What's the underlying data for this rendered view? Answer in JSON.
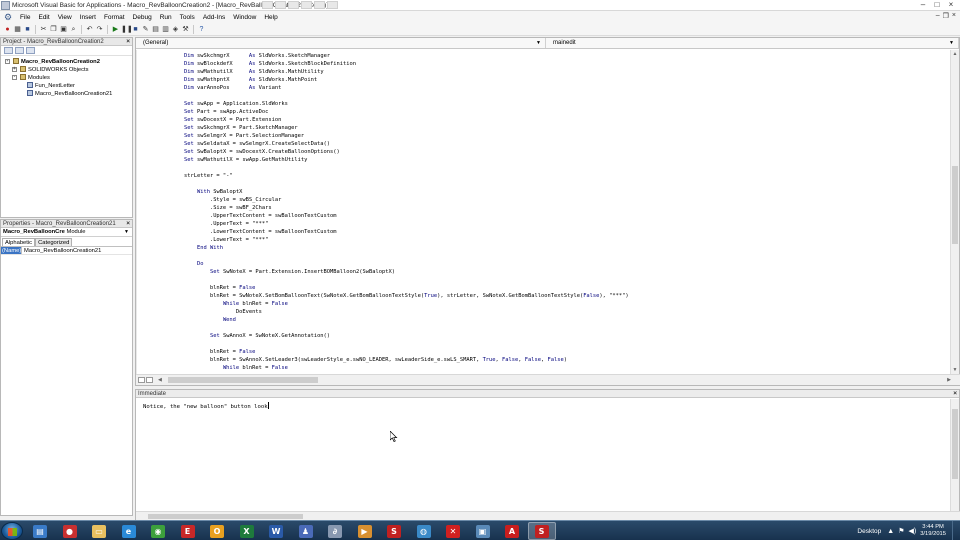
{
  "window": {
    "title": "Microsoft Visual Basic for Applications - Macro_RevBalloonCreation2 - [Macro_RevBalloonCreation21 (Code)]"
  },
  "menu": {
    "items": [
      "File",
      "Edit",
      "View",
      "Insert",
      "Format",
      "Debug",
      "Run",
      "Tools",
      "Add-Ins",
      "Window",
      "Help"
    ]
  },
  "project_pane": {
    "title": "Project - Macro_RevBalloonCreation2",
    "tree": [
      {
        "label": "Macro_RevBalloonCreation2",
        "indent": 0,
        "expander": "-",
        "bold": true,
        "icon": "project-icon"
      },
      {
        "label": "SOLIDWORKS Objects",
        "indent": 1,
        "expander": "+",
        "bold": false,
        "icon": "folder-icon"
      },
      {
        "label": "Modules",
        "indent": 1,
        "expander": "-",
        "bold": false,
        "icon": "folder-icon"
      },
      {
        "label": "Fun_NextLetter",
        "indent": 2,
        "expander": "",
        "bold": false,
        "icon": "module-icon"
      },
      {
        "label": "Macro_RevBalloonCreation21",
        "indent": 2,
        "expander": "",
        "bold": false,
        "icon": "module-icon"
      }
    ]
  },
  "properties_pane": {
    "title": "Properties - Macro_RevBalloonCreation21",
    "object_name": "Macro_RevBalloonCre",
    "object_type": "Module",
    "tabs": [
      "Alphabetic",
      "Categorized"
    ],
    "rows": [
      {
        "name": "(Name)",
        "value": "Macro_RevBalloonCreation21"
      }
    ]
  },
  "code_window": {
    "object_combo": "(General)",
    "procedure_combo": "mainedit",
    "lines": [
      {
        "text": "    Dim swSkchmgrX      As SldWorks.SketchManager",
        "kw": true
      },
      {
        "text": "    Dim swBlockdefX     As SldWorks.SketchBlockDefinition",
        "kw": true
      },
      {
        "text": "    Dim swMathutilX     As SldWorks.MathUtility",
        "kw": true
      },
      {
        "text": "    Dim swMathpntX      As SldWorks.MathPoint",
        "kw": true
      },
      {
        "text": "    Dim varAnnoPos      As Variant",
        "kw": true
      },
      {
        "text": "",
        "kw": false
      },
      {
        "text": "    Set swApp = Application.SldWorks",
        "kw": true
      },
      {
        "text": "    Set Part = swApp.ActiveDoc",
        "kw": true
      },
      {
        "text": "    Set swDocextX = Part.Extension",
        "kw": true
      },
      {
        "text": "    Set swSkchmgrX = Part.SketchManager",
        "kw": true
      },
      {
        "text": "    Set swSelmgrX = Part.SelectionManager",
        "kw": true
      },
      {
        "text": "    Set swSeldataX = swSelmgrX.CreateSelectData()",
        "kw": true
      },
      {
        "text": "    Set SwBaloptX = swDocextX.CreateBalloonOptions()",
        "kw": true
      },
      {
        "text": "    Set swMathutilX = swApp.GetMathUtility",
        "kw": true
      },
      {
        "text": "",
        "kw": false
      },
      {
        "text": "    strLetter = \"-\"",
        "kw": false
      },
      {
        "text": "",
        "kw": false
      },
      {
        "text": "        With SwBaloptX",
        "kw": true
      },
      {
        "text": "            .Style = swBS_Circular",
        "kw": false
      },
      {
        "text": "            .Size = swBF_2Chars",
        "kw": false
      },
      {
        "text": "            .UpperTextContent = swBalloonTextCustom",
        "kw": false
      },
      {
        "text": "            .UpperText = \"***\"",
        "kw": false
      },
      {
        "text": "            .LowerTextContent = swBalloonTextCustom",
        "kw": false
      },
      {
        "text": "            .LowerText = \"***\"",
        "kw": false
      },
      {
        "text": "        End With",
        "kw": true
      },
      {
        "text": "",
        "kw": false
      },
      {
        "text": "        Do",
        "kw": true
      },
      {
        "text": "            Set SwNoteX = Part.Extension.InsertBOMBalloon2(SwBaloptX)",
        "kw": true
      },
      {
        "text": "",
        "kw": false
      },
      {
        "text": "            blnRet = False",
        "kw": false
      },
      {
        "text": "            blnRet = SwNoteX.SetBomBalloonText(SwNoteX.GetBomBalloonTextStyle(True), strLetter, SwNoteX.GetBomBalloonTextStyle(False), \"***\")",
        "kw": false
      },
      {
        "text": "                While blnRet = False",
        "kw": true
      },
      {
        "text": "                    DoEvents",
        "kw": false
      },
      {
        "text": "                Wend",
        "kw": true
      },
      {
        "text": "",
        "kw": false
      },
      {
        "text": "            Set SwAnnoX = SwNoteX.GetAnnotation()",
        "kw": true
      },
      {
        "text": "",
        "kw": false
      },
      {
        "text": "            blnRet = False",
        "kw": false
      },
      {
        "text": "            blnRet = SwAnnoX.SetLeader3(swLeaderStyle_e.swNO_LEADER, swLeaderSide_e.swLS_SMART, True, False, False, False)",
        "kw": false
      },
      {
        "text": "                While blnRet = False",
        "kw": true
      }
    ]
  },
  "immediate_window": {
    "title": "Immediate",
    "text": "Notice, the \"new balloon\" button look"
  },
  "taskbar": {
    "apps": [
      {
        "name": "explorer",
        "color": "#3a7bc8",
        "glyph": "▤"
      },
      {
        "name": "media",
        "color": "#c83030",
        "glyph": "●"
      },
      {
        "name": "folder",
        "color": "#e8c060",
        "glyph": "▭"
      },
      {
        "name": "ie",
        "color": "#2a8ad8",
        "glyph": "e"
      },
      {
        "name": "chrome",
        "color": "#3ca03c",
        "glyph": "◉"
      },
      {
        "name": "edge-red",
        "color": "#c82828",
        "glyph": "E"
      },
      {
        "name": "outlook",
        "color": "#e8a020",
        "glyph": "O"
      },
      {
        "name": "excel",
        "color": "#1e7a3c",
        "glyph": "X"
      },
      {
        "name": "word",
        "color": "#2a5aa8",
        "glyph": "W"
      },
      {
        "name": "app-blue",
        "color": "#4a6ab8",
        "glyph": "♟"
      },
      {
        "name": "app-gray",
        "color": "#8898b0",
        "glyph": "∂"
      },
      {
        "name": "app-orange",
        "color": "#d89030",
        "glyph": "▶"
      },
      {
        "name": "solidworks",
        "color": "#c02020",
        "glyph": "S"
      },
      {
        "name": "app-globe",
        "color": "#3a8ac8",
        "glyph": "◍"
      },
      {
        "name": "app-x",
        "color": "#d02020",
        "glyph": "✕"
      },
      {
        "name": "app-window",
        "color": "#5a8ab8",
        "glyph": "▣"
      },
      {
        "name": "pdf",
        "color": "#c81e1e",
        "glyph": "A"
      },
      {
        "name": "solidworks-active",
        "color": "#c02020",
        "glyph": "S"
      }
    ],
    "desktop_label": "Desktop",
    "time": "3:44 PM",
    "date": "3/19/2015"
  }
}
